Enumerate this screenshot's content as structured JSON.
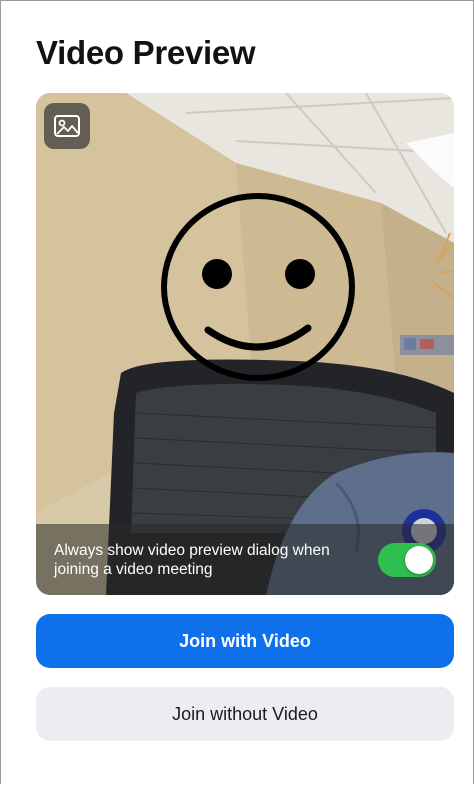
{
  "page": {
    "title": "Video Preview"
  },
  "preview": {
    "background_icon": "image-icon",
    "face_overlay": "smiley-face",
    "always_show_text": "Always show video preview dialog when joining a video meeting",
    "always_show_toggle": {
      "on": true,
      "color": "#2fbf4f"
    }
  },
  "buttons": {
    "join_with_video": "Join with Video",
    "join_without_video": "Join without Video"
  },
  "colors": {
    "primary": "#0e71eb",
    "secondary_button": "#ececf3",
    "toggle_on": "#2fbf4f"
  }
}
